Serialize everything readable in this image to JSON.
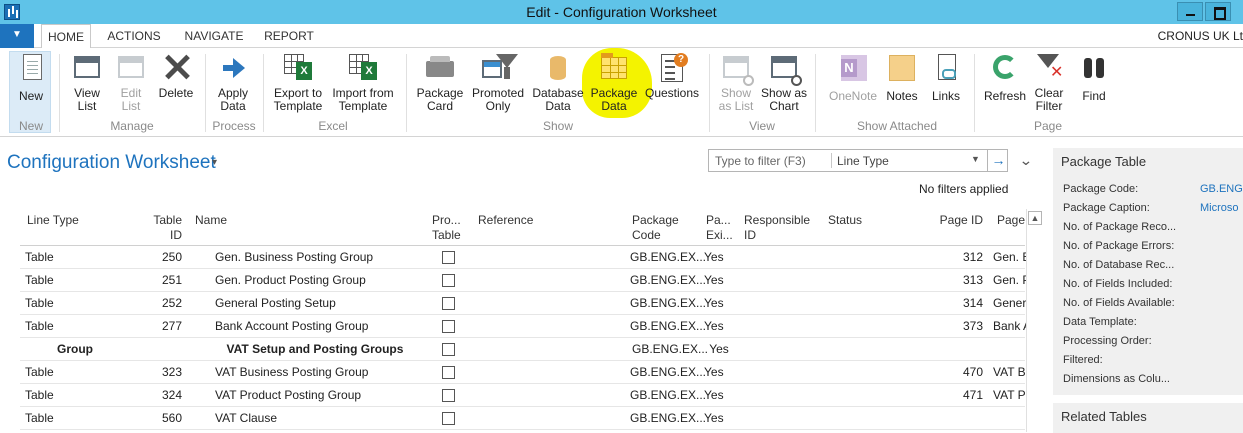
{
  "window": {
    "title": "Edit - Configuration Worksheet"
  },
  "ribbon_tabs": [
    "HOME",
    "ACTIONS",
    "NAVIGATE",
    "REPORT"
  ],
  "company": "CRONUS UK Lt",
  "ribbon": {
    "new": "New",
    "view_list": [
      "View",
      "List"
    ],
    "edit_list": [
      "Edit",
      "List"
    ],
    "delete": "Delete",
    "apply_data": [
      "Apply",
      "Data"
    ],
    "export_template": [
      "Export to",
      "Template"
    ],
    "import_template": [
      "Import from",
      "Template"
    ],
    "package_card": [
      "Package",
      "Card"
    ],
    "promoted_only": [
      "Promoted",
      "Only"
    ],
    "database_data": [
      "Database",
      "Data"
    ],
    "package_data": [
      "Package",
      "Data"
    ],
    "questions": "Questions",
    "show_as_list": [
      "Show",
      "as List"
    ],
    "show_as_chart": [
      "Show as",
      "Chart"
    ],
    "onenote": "OneNote",
    "notes": "Notes",
    "links": "Links",
    "refresh": "Refresh",
    "clear_filter": [
      "Clear",
      "Filter"
    ],
    "find": "Find",
    "groups": [
      "New",
      "Manage",
      "Process",
      "Excel",
      "Show",
      "View",
      "Show Attached",
      "Page"
    ]
  },
  "page": {
    "title": "Configuration Worksheet",
    "filter_placeholder": "Type to filter (F3)",
    "filter_field": "Line Type",
    "no_filters": "No filters applied"
  },
  "columns": {
    "line_type": "Line Type",
    "table_id": "Table ID",
    "name": "Name",
    "promoted_table": [
      "Pro...",
      "Table"
    ],
    "reference": "Reference",
    "package_code": [
      "Package",
      "Code"
    ],
    "package_exists": [
      "Pa...",
      "Exi..."
    ],
    "responsible_id": [
      "Responsible",
      "ID"
    ],
    "status": "Status",
    "page_id": "Page ID",
    "page_caption": "Page"
  },
  "rows": [
    {
      "line_type": "Table",
      "table_id": "250",
      "name": "Gen. Business Posting Group",
      "package_code": "GB.ENG.EX...",
      "package_exists": "Yes",
      "page_id": "312",
      "page_caption": "Gen. B"
    },
    {
      "line_type": "Table",
      "table_id": "251",
      "name": "Gen. Product Posting Group",
      "package_code": "GB.ENG.EX...",
      "package_exists": "Yes",
      "page_id": "313",
      "page_caption": "Gen. P"
    },
    {
      "line_type": "Table",
      "table_id": "252",
      "name": "General Posting Setup",
      "package_code": "GB.ENG.EX...",
      "package_exists": "Yes",
      "page_id": "314",
      "page_caption": "Genera"
    },
    {
      "line_type": "Table",
      "table_id": "277",
      "name": "Bank Account Posting Group",
      "package_code": "GB.ENG.EX...",
      "package_exists": "Yes",
      "page_id": "373",
      "page_caption": "Bank A"
    },
    {
      "line_type": "Group",
      "table_id": "",
      "name": "VAT Setup and Posting Groups",
      "package_code": "GB.ENG.EX...",
      "package_exists": "Yes",
      "page_id": "",
      "page_caption": ""
    },
    {
      "line_type": "Table",
      "table_id": "323",
      "name": "VAT Business Posting Group",
      "package_code": "GB.ENG.EX...",
      "package_exists": "Yes",
      "page_id": "470",
      "page_caption": "VAT B"
    },
    {
      "line_type": "Table",
      "table_id": "324",
      "name": "VAT Product Posting Group",
      "package_code": "GB.ENG.EX...",
      "package_exists": "Yes",
      "page_id": "471",
      "page_caption": "VAT P"
    },
    {
      "line_type": "Table",
      "table_id": "560",
      "name": "VAT Clause",
      "package_code": "GB.ENG.EX...",
      "package_exists": "Yes",
      "page_id": "",
      "page_caption": ""
    }
  ],
  "factbox": {
    "title": "Package Table",
    "fields": [
      {
        "label": "Package Code:",
        "value": "GB.ENG"
      },
      {
        "label": "Package Caption:",
        "value": "Microso"
      },
      {
        "label": "No. of Package Reco...",
        "value": ""
      },
      {
        "label": "No. of Package Errors:",
        "value": ""
      },
      {
        "label": "No. of Database Rec...",
        "value": ""
      },
      {
        "label": "No. of Fields Included:",
        "value": ""
      },
      {
        "label": "No. of Fields Available:",
        "value": ""
      },
      {
        "label": "Data Template:",
        "value": ""
      },
      {
        "label": "Processing Order:",
        "value": ""
      },
      {
        "label": "Filtered:",
        "value": ""
      },
      {
        "label": "Dimensions as Colu...",
        "value": ""
      }
    ],
    "related_title": "Related Tables"
  },
  "colors": {
    "titlebar": "#5fc3e8",
    "accent": "#1e73be",
    "highlight": "#f4f300"
  }
}
